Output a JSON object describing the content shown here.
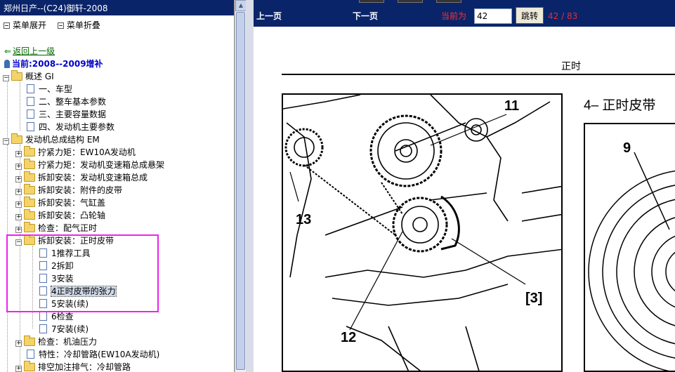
{
  "left_panel": {
    "title": "郑州日产--(C24)御轩-2008",
    "expand_all": "菜单展开",
    "collapse_all": "菜单折叠",
    "back_link": "返回上一级",
    "current": "当前:2008--2009增补"
  },
  "tree": {
    "gi": "概述 GI",
    "gi_1": "一、车型",
    "gi_2": "二、整车基本参数",
    "gi_3": "三、主要容量数据",
    "gi_4": "四、发动机主要参数",
    "em": "发动机总成结构 EM",
    "em_1": "拧紧力矩：EW10A发动机",
    "em_2": "拧紧力矩：发动机变速箱总成悬架",
    "em_3": "拆卸安装：发动机变速箱总成",
    "em_4": "拆卸安装：附件的皮带",
    "em_5": "拆卸安装：气缸盖",
    "em_6": "拆卸安装：凸轮轴",
    "em_7": "检查：配气正时",
    "em_8": "拆卸安装：正时皮带",
    "em_8_1": "1推荐工具",
    "em_8_2": "2拆卸",
    "em_8_3": "3安装",
    "em_8_4": "4正时皮带的张力",
    "em_8_5": "5安装(续)",
    "em_8_6": "6检查",
    "em_8_7": "7安装(续)",
    "em_9": "检查：机油压力",
    "em_10": "特性：冷却管路(EW10A发动机)",
    "em_11": "排空加注排气：冷却管路"
  },
  "nav": {
    "prev": "上一页",
    "next": "下一页",
    "current_label": "当前为",
    "page_value": "42",
    "jump": "跳转",
    "page_count": "42 / 83"
  },
  "document": {
    "header": "正时",
    "figure2_title": "4– 正时皮带",
    "callouts": {
      "c11": "11",
      "c13": "13",
      "c12": "12",
      "c3": "[3]",
      "c9": "9"
    }
  },
  "colors": {
    "title_bar": "#0a246a",
    "highlight": "#ee22ee",
    "page_label": "#ff3030"
  }
}
